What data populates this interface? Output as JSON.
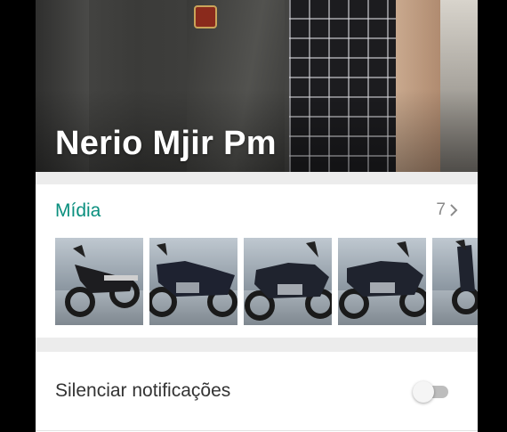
{
  "profile": {
    "name": "Nerio Mjir Pm"
  },
  "media": {
    "title": "Mídia",
    "count": "7",
    "thumbnails": [
      {
        "icon": "motorcycle-photo"
      },
      {
        "icon": "motorcycle-photo"
      },
      {
        "icon": "motorcycle-photo"
      },
      {
        "icon": "motorcycle-photo"
      },
      {
        "icon": "motorcycle-photo"
      }
    ]
  },
  "settings": {
    "mute_label": "Silenciar notificações",
    "mute_enabled": false
  },
  "colors": {
    "accent": "#0a8f7e",
    "toggle_off": "#bdbdbd"
  }
}
